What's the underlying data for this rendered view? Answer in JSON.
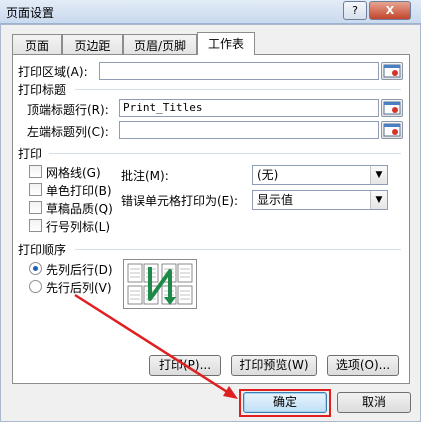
{
  "window": {
    "title": "页面设置",
    "help_label": "?",
    "close_label": "X"
  },
  "tabs": [
    {
      "label": "页面",
      "active": false
    },
    {
      "label": "页边距",
      "active": false
    },
    {
      "label": "页眉/页脚",
      "active": false
    },
    {
      "label": "工作表",
      "active": true
    }
  ],
  "print_area": {
    "label": "打印区域(A):",
    "value": ""
  },
  "print_titles": {
    "section_label": "打印标题",
    "rows_label": "顶端标题行(R):",
    "rows_value": "Print_Titles",
    "cols_label": "左端标题列(C):",
    "cols_value": ""
  },
  "print": {
    "section_label": "打印",
    "checkboxes": [
      {
        "label": "网格线(G)",
        "checked": false
      },
      {
        "label": "单色打印(B)",
        "checked": false
      },
      {
        "label": "草稿品质(Q)",
        "checked": false
      },
      {
        "label": "行号列标(L)",
        "checked": false
      }
    ],
    "comments_label": "批注(M):",
    "comments_value": "(无)",
    "errors_label": "错误单元格打印为(E):",
    "errors_value": "显示值"
  },
  "page_order": {
    "section_label": "打印顺序",
    "options": [
      {
        "label": "先列后行(D)",
        "selected": true
      },
      {
        "label": "先行后列(V)",
        "selected": false
      }
    ]
  },
  "buttons": {
    "print": "打印(P)...",
    "preview": "打印预览(W)",
    "options": "选项(O)...",
    "ok": "确定",
    "cancel": "取消"
  },
  "colors": {
    "accent": "#1f5fb8",
    "highlight_red": "#e02020",
    "diagram_green": "#1e8a4a"
  },
  "icons": {
    "ref_button": "range-select-icon",
    "arrow": "annotation-arrow"
  }
}
